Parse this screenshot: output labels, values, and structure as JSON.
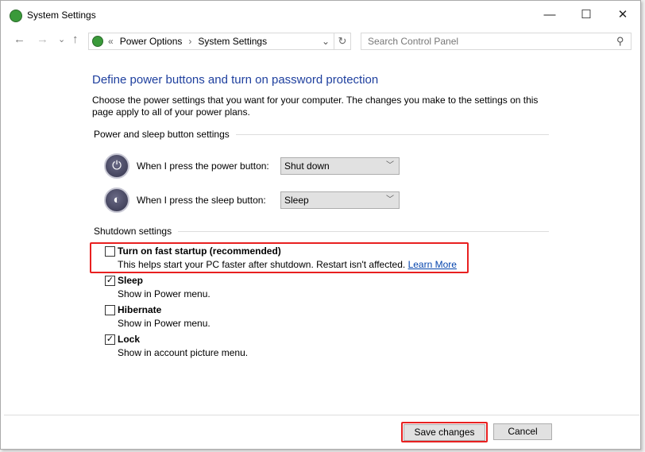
{
  "window": {
    "title": "System Settings",
    "minimize": "—",
    "maximize": "☐",
    "close": "✕"
  },
  "nav": {
    "back": "←",
    "forward": "→",
    "recent": "⌄",
    "up": "↑",
    "breadcrumb_sep": "«",
    "breadcrumbs": [
      "Power Options",
      "System Settings"
    ],
    "crumb_arrow": "›",
    "dropdown": "⌄",
    "refresh": "↻",
    "search_placeholder": "Search Control Panel",
    "search_icon": "⚲"
  },
  "main": {
    "heading": "Define power buttons and turn on password protection",
    "description": "Choose the power settings that you want for your computer. The changes you make to the settings on this page apply to all of your power plans.",
    "power_section": "Power and sleep button settings",
    "power_button_label": "When I press the power button:",
    "power_button_value": "Shut down",
    "sleep_button_label": "When I press the sleep button:",
    "sleep_button_value": "Sleep",
    "shutdown_section": "Shutdown settings",
    "options": [
      {
        "label": "Turn on fast startup (recommended)",
        "desc": "This helps start your PC faster after shutdown. Restart isn't affected.",
        "link": "Learn More",
        "checked": false
      },
      {
        "label": "Sleep",
        "desc": "Show in Power menu.",
        "checked": true
      },
      {
        "label": "Hibernate",
        "desc": "Show in Power menu.",
        "checked": false
      },
      {
        "label": "Lock",
        "desc": "Show in account picture menu.",
        "checked": true
      }
    ],
    "check_mark": "✓"
  },
  "footer": {
    "save": "Save changes",
    "cancel": "Cancel"
  },
  "colors": {
    "heading": "#1e3f9e",
    "highlight": "#e82020",
    "link": "#0645ad"
  }
}
